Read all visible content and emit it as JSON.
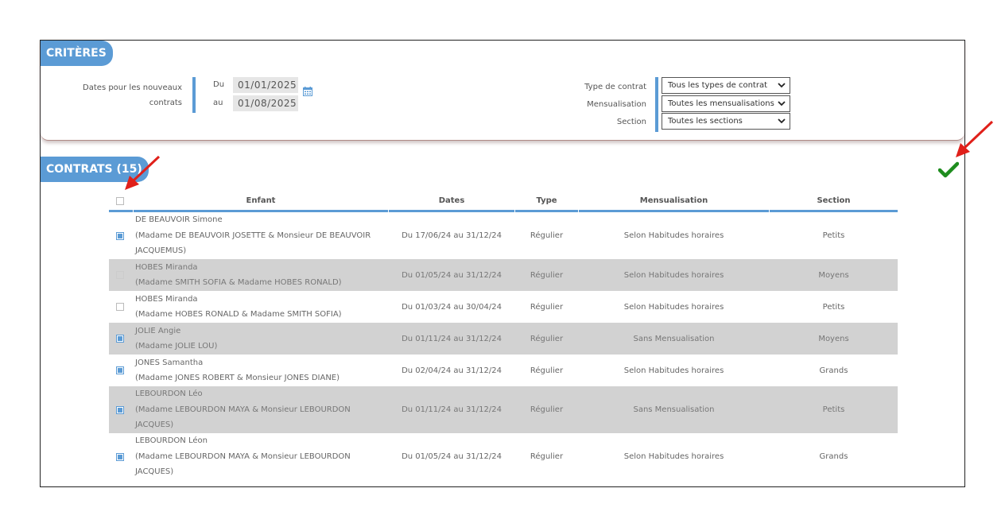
{
  "criteria": {
    "title": "CRITÈRES",
    "dates_label_line1": "Dates pour les nouveaux",
    "dates_label_line2": "contrats",
    "from_label": "Du",
    "from_value": "01/01/2025",
    "to_label": "au",
    "to_value": "01/08/2025",
    "contract_type_label": "Type de contrat",
    "contract_type_value": "Tous les types de contrat",
    "mensualisation_label": "Mensualisation",
    "mensualisation_value": "Toutes les mensualisations",
    "section_label": "Section",
    "section_value": "Toutes les sections"
  },
  "contracts": {
    "title": "CONTRATS (15)",
    "headers": {
      "enfant": "Enfant",
      "dates": "Dates",
      "type": "Type",
      "mensualisation": "Mensualisation",
      "section": "Section"
    },
    "rows": [
      {
        "name": "DE BEAUVOIR Simone",
        "parents1": "(Madame DE BEAUVOIR JOSETTE & Monsieur DE BEAUVOIR",
        "parents2": "JACQUEMUS)",
        "dates": "Du 17/06/24 au 31/12/24",
        "type": "Régulier",
        "mensualisation": "Selon Habitudes horaires",
        "section": "Petits",
        "checked": true
      },
      {
        "name": "HOBES Miranda",
        "parents1": "(Madame SMITH SOFIA & Madame HOBES RONALD)",
        "parents2": "",
        "dates": "Du 01/05/24 au 31/12/24",
        "type": "Régulier",
        "mensualisation": "Selon Habitudes horaires",
        "section": "Moyens",
        "checked": false
      },
      {
        "name": "HOBES Miranda",
        "parents1": "(Madame HOBES RONALD & Madame SMITH SOFIA)",
        "parents2": "",
        "dates": "Du 01/03/24 au 30/04/24",
        "type": "Régulier",
        "mensualisation": "Selon Habitudes horaires",
        "section": "Petits",
        "checked": false
      },
      {
        "name": "JOLIE Angie",
        "parents1": "(Madame JOLIE LOU)",
        "parents2": "",
        "dates": "Du 01/11/24 au 31/12/24",
        "type": "Régulier",
        "mensualisation": "Sans Mensualisation",
        "section": "Moyens",
        "checked": true
      },
      {
        "name": "JONES Samantha",
        "parents1": "(Madame JONES ROBERT & Monsieur JONES DIANE)",
        "parents2": "",
        "dates": "Du 02/04/24 au 31/12/24",
        "type": "Régulier",
        "mensualisation": "Selon Habitudes horaires",
        "section": "Grands",
        "checked": true
      },
      {
        "name": "LEBOURDON Léo",
        "parents1": "(Madame LEBOURDON MAYA & Monsieur LEBOURDON",
        "parents2": "JACQUES)",
        "dates": "Du 01/11/24 au 31/12/24",
        "type": "Régulier",
        "mensualisation": "Sans Mensualisation",
        "section": "Petits",
        "checked": true
      },
      {
        "name": "LEBOURDON Léon",
        "parents1": "(Madame LEBOURDON MAYA & Monsieur LEBOURDON",
        "parents2": "JACQUES)",
        "dates": "Du 01/05/24 au 31/12/24",
        "type": "Régulier",
        "mensualisation": "Selon Habitudes horaires",
        "section": "Grands",
        "checked": true
      }
    ]
  },
  "colors": {
    "accent": "#5b9bd5",
    "row_alt": "#d2d2d2",
    "validate": "#1e8c1e",
    "annotation_arrow": "#e0201a"
  },
  "icons": {
    "calendar": "calendar-icon",
    "validate": "checkmark-icon",
    "dropdown": "chevron-down-icon"
  }
}
